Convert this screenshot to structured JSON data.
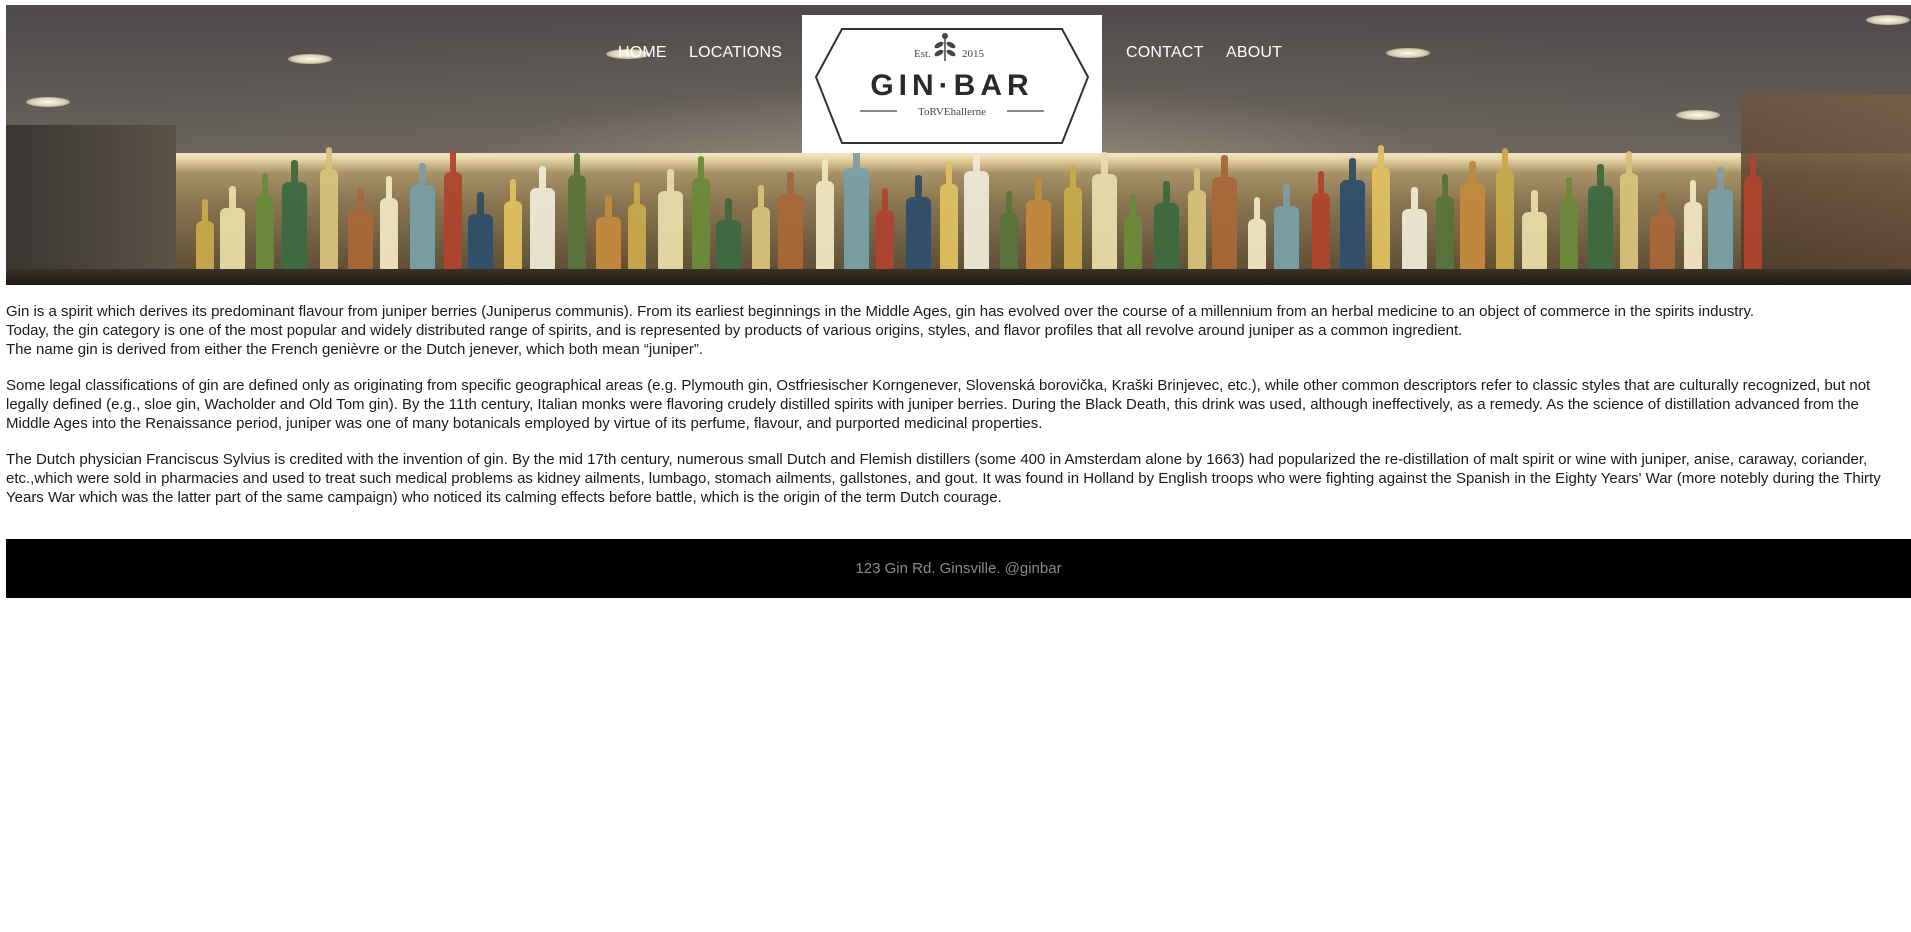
{
  "nav": {
    "home": "HOME",
    "locations": "LOCATIONS",
    "contact": "CONTACT",
    "about": "ABOUT"
  },
  "logo": {
    "est": "Est.",
    "year": "2015",
    "name": "GIN·BAR",
    "tagline": "ToRVEhallerne"
  },
  "content": {
    "p1": [
      "Gin is a spirit which derives its predominant flavour from juniper berries (Juniperus communis). From its earliest beginnings in the Middle Ages, gin has evolved over the course of a millennium from an herbal medicine to an object of commerce in the spirits industry.",
      "Today, the gin category is one of the most popular and widely distributed range of spirits, and is represented by products of various origins, styles, and flavor profiles that all revolve around juniper as a common ingredient.",
      "The name gin is derived from either the French genièvre or the Dutch jenever, which both mean “juniper”."
    ],
    "p2": "Some legal classifications of gin are defined only as originating from specific geographical areas (e.g. Plymouth gin, Ostfriesischer Korngenever, Slovenská borovička, Kraški Brinjevec, etc.), while other common descriptors refer to classic styles that are culturally recognized, but not legally defined (e.g., sloe gin, Wacholder and Old Tom gin). By the 11th century, Italian monks were flavoring crudely distilled spirits with juniper berries. During the Black Death, this drink was used, although ineffectively, as a remedy. As the science of distillation advanced from the Middle Ages into the Renaissance period, juniper was one of many botanicals employed by virtue of its perfume, flavour, and purported medicinal properties.",
    "p3": "The Dutch physician Franciscus Sylvius is credited with the invention of gin. By the mid 17th century, numerous small Dutch and Flemish distillers (some 400 in Amsterdam alone by 1663) had popularized the re-distillation of malt spirit or wine with juniper, anise, caraway, coriander, etc.,which were sold in pharmacies and used to treat such medical problems as kidney ailments, lumbago, stomach ailments, gallstones, and gout. It was found in Holland by English troops who were fighting against the Spanish in the Eighty Years' War (more notebly during the Thirty Years War which was the latter part of the same campaign) who noticed its calming effects before battle, which is the origin of the term Dutch courage."
  },
  "footer": {
    "text": "123 Gin Rd. Ginsville. @ginbar"
  },
  "colors": {
    "footer_bg": "#000000",
    "footer_text": "#8a8a8a",
    "nav_text": "#ffffff"
  }
}
